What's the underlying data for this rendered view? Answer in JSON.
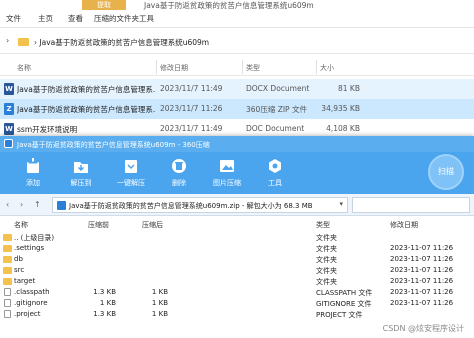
{
  "explorer": {
    "tabs": {
      "file": "文件",
      "home": "主页",
      "view": "查看",
      "compressed_tools": "压缩的文件夹工具",
      "extract": "提取"
    },
    "context_title": "Java基于防返贫政策的贫苦户信息管理系统u609m",
    "breadcrumb": "Java基于防返贫政策的贫苦户信息管理系统u609m",
    "columns": {
      "name": "名称",
      "date": "修改日期",
      "type": "类型",
      "size": "大小"
    },
    "files": [
      {
        "name": "Java基于防返贫政策的贫苦户信息管理系...",
        "date": "2023/11/7 11:49",
        "type": "DOCX Document",
        "size": "81 KB",
        "icon": "W",
        "icon_color": "#2b579a"
      },
      {
        "name": "Java基于防返贫政策的贫苦户信息管理系...",
        "date": "2023/11/7 11:26",
        "type": "360压缩 ZIP 文件",
        "size": "34,935 KB",
        "icon": "Z",
        "icon_color": "#2c7fd6"
      },
      {
        "name": "ssm开发环境说明",
        "date": "2023/11/7 11:49",
        "type": "DOC Document",
        "size": "4,108 KB",
        "icon": "W",
        "icon_color": "#2b579a"
      }
    ]
  },
  "zip": {
    "title": "Java基于防返贫政策的贫苦户信息管理系统u609m - 360压缩",
    "toolbar": [
      {
        "label": "添加",
        "icon": "add-icon"
      },
      {
        "label": "解压到",
        "icon": "extract-to-icon"
      },
      {
        "label": "一键解压",
        "icon": "one-click-extract-icon"
      },
      {
        "label": "删除",
        "icon": "delete-icon"
      },
      {
        "label": "图片压缩",
        "icon": "image-compress-icon"
      },
      {
        "label": "工具",
        "icon": "tools-icon"
      }
    ],
    "scan_label": "扫描",
    "path_text": "Java基于防返贫政策的贫苦户信息管理系统u609m.zip - 解包大小为 68.3 MB",
    "columns": {
      "name": "名称",
      "size": "压缩前",
      "compressed": "压缩后",
      "type": "类型",
      "date": "修改日期"
    },
    "rows": [
      {
        "name": ".. (上级目录)",
        "size": "",
        "compressed": "",
        "type": "文件夹",
        "date": "",
        "kind": "folder"
      },
      {
        "name": ".settings",
        "size": "",
        "compressed": "",
        "type": "文件夹",
        "date": "2023-11-07 11:26",
        "kind": "folder"
      },
      {
        "name": "db",
        "size": "",
        "compressed": "",
        "type": "文件夹",
        "date": "2023-11-07 11:26",
        "kind": "folder"
      },
      {
        "name": "src",
        "size": "",
        "compressed": "",
        "type": "文件夹",
        "date": "2023-11-07 11:26",
        "kind": "folder"
      },
      {
        "name": "target",
        "size": "",
        "compressed": "",
        "type": "文件夹",
        "date": "2023-11-07 11:26",
        "kind": "folder"
      },
      {
        "name": ".classpath",
        "size": "1.3 KB",
        "compressed": "1 KB",
        "type": "CLASSPATH 文件",
        "date": "2023-11-07 11:26",
        "kind": "file"
      },
      {
        "name": ".gitignore",
        "size": "1 KB",
        "compressed": "1 KB",
        "type": "GITIGNORE 文件",
        "date": "2023-11-07 11:26",
        "kind": "file"
      },
      {
        "name": ".project",
        "size": "1.3 KB",
        "compressed": "1 KB",
        "type": "PROJECT 文件",
        "date": "2023-11-07 11:26",
        "kind": "file"
      }
    ]
  },
  "watermark": "CSDN @炫安程序设计"
}
